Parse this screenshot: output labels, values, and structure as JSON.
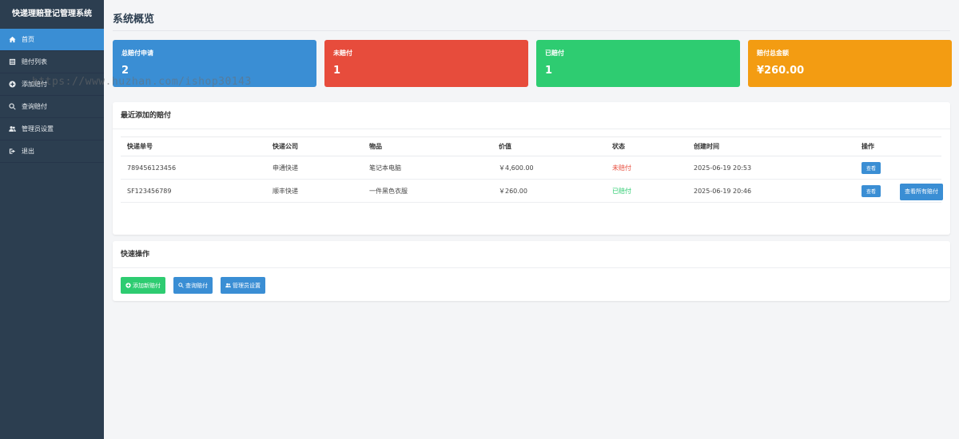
{
  "sidebar": {
    "title": "快递理赔登记管理系统",
    "items": [
      {
        "label": "首页",
        "icon": "home-icon",
        "active": true
      },
      {
        "label": "赔付列表",
        "icon": "list-icon"
      },
      {
        "label": "添加赔付",
        "icon": "plus-circle-icon"
      },
      {
        "label": "查询赔付",
        "icon": "search-icon"
      },
      {
        "label": "管理员设置",
        "icon": "users-icon"
      },
      {
        "label": "退出",
        "icon": "sign-out-icon"
      }
    ]
  },
  "header": {
    "title": "系统概览"
  },
  "stats": [
    {
      "label": "总赔付申请",
      "value": "2",
      "color": "#3a8ed4"
    },
    {
      "label": "未赔付",
      "value": "1",
      "color": "#e74c3c"
    },
    {
      "label": "已赔付",
      "value": "1",
      "color": "#2ecc71"
    },
    {
      "label": "赔付总金额",
      "value": "¥260.00",
      "color": "#f39c12"
    }
  ],
  "recent": {
    "title": "最近添加的赔付",
    "columns": [
      "快递单号",
      "快递公司",
      "物品",
      "价值",
      "状态",
      "创建时间",
      "操作"
    ],
    "rows": [
      {
        "tracking": "789456123456",
        "company": "申通快递",
        "item": "笔记本电脑",
        "value": "￥4,600.00",
        "status": "未赔付",
        "created": "2025-06-19 20:53",
        "action": "查看"
      },
      {
        "tracking": "SF123456789",
        "company": "顺丰快递",
        "item": "一件黑色衣服",
        "value": "￥260.00",
        "status": "已赔付",
        "created": "2025-06-19 20:46",
        "action": "查看"
      }
    ],
    "view_all_label": "查看所有赔付"
  },
  "quick": {
    "title": "快速操作",
    "buttons": [
      {
        "label": "添加新赔付",
        "icon": "plus-circle-icon",
        "color": "#2ecc71"
      },
      {
        "label": "查询赔付",
        "icon": "search-icon",
        "color": "#3a8ed4"
      },
      {
        "label": "管理员设置",
        "icon": "users-icon",
        "color": "#3a8ed4"
      }
    ]
  },
  "watermark": "https://www.huzhan.com/ishop30143"
}
